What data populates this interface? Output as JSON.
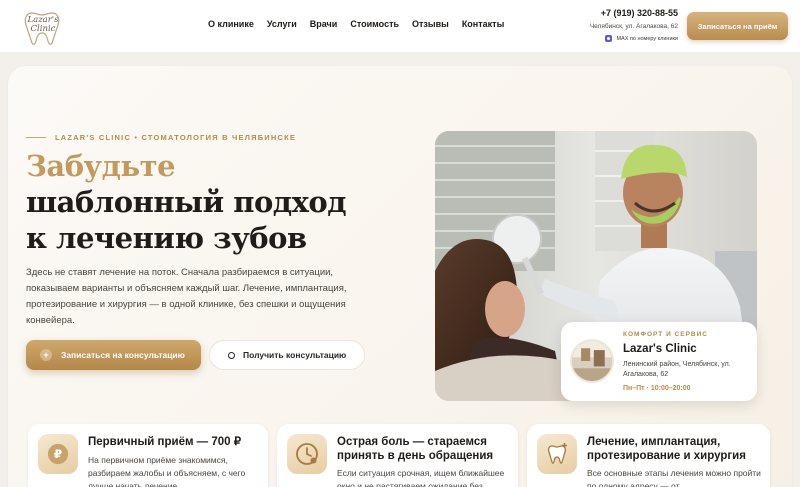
{
  "header": {
    "logo_text": "Lazar's Clinic",
    "nav": [
      "О клинике",
      "Услуги",
      "Врачи",
      "Стоимость",
      "Отзывы",
      "Контакты"
    ],
    "phone": "+7 (919) 320-88-55",
    "address": "Челябинск, ул. Агалакова, 62",
    "max_label": "MAX по номеру клиники",
    "cta": "Записаться на приём"
  },
  "hero": {
    "eyebrow": "LAZAR'S CLINIC • СТОМАТОЛОГИЯ В ЧЕЛЯБИНСКЕ",
    "title_accent": "Забудьте",
    "title_line2": "шаблонный подход",
    "title_line3": "к лечению зубов",
    "description": "Здесь не ставят лечение на поток. Сначала разбираемся в ситуации, показываем варианты и объясняем каждый шаг. Лечение, имплантация, протезирование и хирургия — в одной клинике, без спешки и ощущения конвейера.",
    "primary_button": "Записаться на консультацию",
    "primary_button_icon": "+",
    "secondary_button": "Получить консультацию"
  },
  "info_card": {
    "eyebrow": "КОМФОРТ И СЕРВИС",
    "title": "Lazar's Clinic",
    "address": "Ленинский район, Челябинск, ул. Агалакова, 62",
    "hours": "Пн–Пт · 10:00–20:00"
  },
  "features": [
    {
      "icon": "ruble-icon",
      "icon_glyph": "₽",
      "title": "Первичный приём — 700 ₽",
      "text": "На первичном приёме знакомимся, разбираем жалобы и объясняем, с чего лучше начать лечение."
    },
    {
      "icon": "clock-icon",
      "title": "Острая боль — стараемся принять в день обращения",
      "text": "Если ситуация срочная, ищем ближайшее окно и не растягиваем ожидание без"
    },
    {
      "icon": "tooth-plus-icon",
      "title": "Лечение, имплантация, протезирование и хирургия",
      "text": "Все основные этапы лечения можно пройти по одному адресу — от"
    }
  ],
  "colors": {
    "accent_gold": "#c39a5c",
    "button_gold": "#b48749",
    "text_dark": "#1f1c19"
  }
}
